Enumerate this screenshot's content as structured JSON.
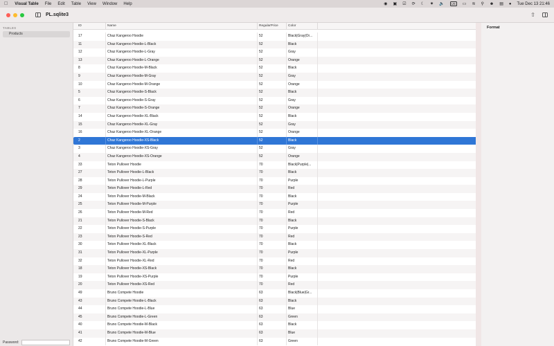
{
  "menubar": {
    "app_name": "Visual Table",
    "menus": [
      "File",
      "Edit",
      "Table",
      "View",
      "Window",
      "Help"
    ],
    "keyboard": "US",
    "datetime": "Tue Dec 13  21:46"
  },
  "window": {
    "title": "PL.sqlite3"
  },
  "sidebar": {
    "header": "TABLES",
    "items": [
      {
        "label": "Products"
      }
    ],
    "password_label": "Password:",
    "password_value": ""
  },
  "table": {
    "columns": [
      "ID",
      "Name",
      "RegularPrice",
      "Color"
    ],
    "selected_index": 13,
    "rows": [
      [
        "17",
        "Chaz Kangeroo Hoodie",
        "52",
        "Black|Gray|Or..."
      ],
      [
        "11",
        "Chaz Kangeroo Hoodie-L-Black",
        "52",
        "Black"
      ],
      [
        "12",
        "Chaz Kangeroo Hoodie-L-Gray",
        "52",
        "Gray"
      ],
      [
        "13",
        "Chaz Kangeroo Hoodie-L-Orange",
        "52",
        "Orange"
      ],
      [
        "8",
        "Chaz Kangeroo Hoodie-M-Black",
        "52",
        "Black"
      ],
      [
        "9",
        "Chaz Kangeroo Hoodie-M-Gray",
        "52",
        "Gray"
      ],
      [
        "10",
        "Chaz Kangeroo Hoodie-M-Orange",
        "52",
        "Orange"
      ],
      [
        "5",
        "Chaz Kangeroo Hoodie-S-Black",
        "52",
        "Black"
      ],
      [
        "6",
        "Chaz Kangeroo Hoodie-S-Gray",
        "52",
        "Gray"
      ],
      [
        "7",
        "Chaz Kangeroo Hoodie-S-Orange",
        "52",
        "Orange"
      ],
      [
        "14",
        "Chaz Kangeroo Hoodie-XL-Black",
        "52",
        "Black"
      ],
      [
        "15",
        "Chaz Kangeroo Hoodie-XL-Gray",
        "52",
        "Gray"
      ],
      [
        "16",
        "Chaz Kangeroo Hoodie-XL-Orange",
        "52",
        "Orange"
      ],
      [
        "2",
        "Chaz Kangeroo Hoodie-XS-Black",
        "52",
        "Black"
      ],
      [
        "3",
        "Chaz Kangeroo Hoodie-XS-Gray",
        "52",
        "Gray"
      ],
      [
        "4",
        "Chaz Kangeroo Hoodie-XS-Orange",
        "52",
        "Orange"
      ],
      [
        "33",
        "Teton Pullover Hoodie",
        "70",
        "Black|Purple|..."
      ],
      [
        "27",
        "Teton Pullover Hoodie-L-Black",
        "70",
        "Black"
      ],
      [
        "28",
        "Teton Pullover Hoodie-L-Purple",
        "70",
        "Purple"
      ],
      [
        "29",
        "Teton Pullover Hoodie-L-Red",
        "70",
        "Red"
      ],
      [
        "24",
        "Teton Pullover Hoodie-M-Black",
        "70",
        "Black"
      ],
      [
        "25",
        "Teton Pullover Hoodie-M-Purple",
        "70",
        "Purple"
      ],
      [
        "26",
        "Teton Pullover Hoodie-M-Red",
        "70",
        "Red"
      ],
      [
        "21",
        "Teton Pullover Hoodie-S-Black",
        "70",
        "Black"
      ],
      [
        "22",
        "Teton Pullover Hoodie-S-Purple",
        "70",
        "Purple"
      ],
      [
        "23",
        "Teton Pullover Hoodie-S-Red",
        "70",
        "Red"
      ],
      [
        "30",
        "Teton Pullover Hoodie-XL-Black",
        "70",
        "Black"
      ],
      [
        "31",
        "Teton Pullover Hoodie-XL-Purple",
        "70",
        "Purple"
      ],
      [
        "32",
        "Teton Pullover Hoodie-XL-Red",
        "70",
        "Red"
      ],
      [
        "18",
        "Teton Pullover Hoodie-XS-Black",
        "70",
        "Black"
      ],
      [
        "19",
        "Teton Pullover Hoodie-XS-Purple",
        "70",
        "Purple"
      ],
      [
        "20",
        "Teton Pullover Hoodie-XS-Red",
        "70",
        "Red"
      ],
      [
        "49",
        "Bruno Compete Hoodie",
        "63",
        "Black|Blue|Gr..."
      ],
      [
        "43",
        "Bruno Compete Hoodie-L-Black",
        "63",
        "Black"
      ],
      [
        "44",
        "Bruno Compete Hoodie-L-Blue",
        "63",
        "Blue"
      ],
      [
        "45",
        "Bruno Compete Hoodie-L-Green",
        "63",
        "Green"
      ],
      [
        "40",
        "Bruno Compete Hoodie-M-Black",
        "63",
        "Black"
      ],
      [
        "41",
        "Bruno Compete Hoodie-M-Blue",
        "63",
        "Blue"
      ],
      [
        "42",
        "Bruno Compete Hoodie-M-Green",
        "63",
        "Green"
      ]
    ]
  },
  "inspector": {
    "title": "Format"
  },
  "colors": {
    "selection": "#2f76d6",
    "close": "#fe5f57",
    "minimize": "#febc2e",
    "maximize": "#28c840"
  }
}
